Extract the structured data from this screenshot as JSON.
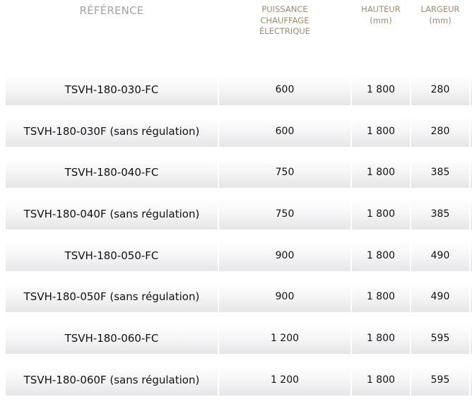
{
  "headers": {
    "reference": "RÉFÉRENCE",
    "puissance": [
      "PUISSANCE",
      "CHAUFFAGE",
      "ÉLECTRIQUE"
    ],
    "hauteur": [
      "HAUTEUR",
      "(mm)"
    ],
    "largeur": [
      "LARGEUR",
      "(mm)"
    ]
  },
  "rows": [
    {
      "reference": "TSVH-180-030-FC",
      "puissance": "600",
      "hauteur": "1 800",
      "largeur": "280"
    },
    {
      "reference": "TSVH-180-030F (sans régulation)",
      "puissance": "600",
      "hauteur": "1 800",
      "largeur": "280"
    },
    {
      "reference": "TSVH-180-040-FC",
      "puissance": "750",
      "hauteur": "1 800",
      "largeur": "385"
    },
    {
      "reference": "TSVH-180-040F (sans régulation)",
      "puissance": "750",
      "hauteur": "1 800",
      "largeur": "385"
    },
    {
      "reference": "TSVH-180-050-FC",
      "puissance": "900",
      "hauteur": "1 800",
      "largeur": "490"
    },
    {
      "reference": "TSVH-180-050F (sans régulation)",
      "puissance": "900",
      "hauteur": "1 800",
      "largeur": "490"
    },
    {
      "reference": "TSVH-180-060-FC",
      "puissance": "1 200",
      "hauteur": "1 800",
      "largeur": "595"
    },
    {
      "reference": "TSVH-180-060F (sans régulation)",
      "puissance": "1 200",
      "hauteur": "1 800",
      "largeur": "595"
    }
  ]
}
